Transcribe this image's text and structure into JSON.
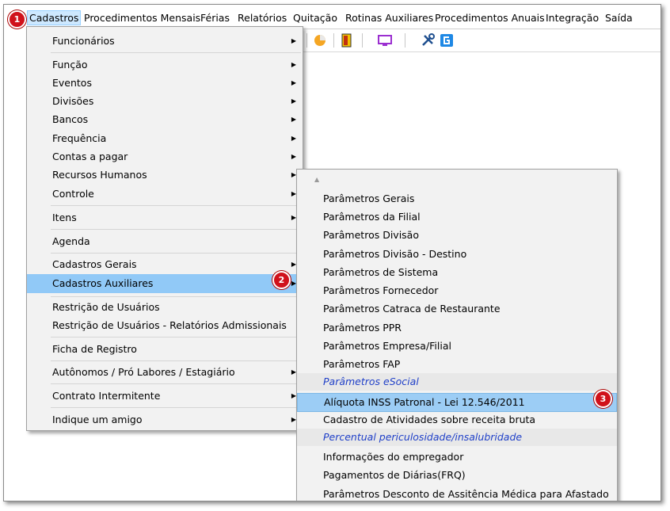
{
  "menubar": {
    "items": [
      "Cadastros",
      "Procedimentos Mensais",
      "Férias",
      "Relatórios",
      "Quitação",
      "Rotinas Auxiliares",
      "Procedimentos Anuais",
      "Integração",
      "Saída"
    ]
  },
  "toolbar": {
    "icons": [
      "pie-chart-icon",
      "exit-door-icon",
      "monitor-icon",
      "tools-icon",
      "app-settings-icon"
    ]
  },
  "callouts": [
    "1",
    "2",
    "3"
  ],
  "cadastros_menu": {
    "items": [
      {
        "label": "Funcionários",
        "submenu": true
      },
      {
        "label": "Função",
        "submenu": true
      },
      {
        "label": "Eventos",
        "submenu": true
      },
      {
        "label": "Divisões",
        "submenu": true
      },
      {
        "label": "Bancos",
        "submenu": true
      },
      {
        "label": "Frequência",
        "submenu": true
      },
      {
        "label": "Contas a pagar",
        "submenu": true
      },
      {
        "label": "Recursos Humanos",
        "submenu": true
      },
      {
        "label": "Controle",
        "submenu": true
      },
      {
        "label": "Itens",
        "submenu": true
      },
      {
        "label": "Agenda",
        "submenu": false
      },
      {
        "label": "Cadastros Gerais",
        "submenu": true
      },
      {
        "label": "Cadastros Auxiliares",
        "submenu": true,
        "highlighted": true
      },
      {
        "label": "Restrição de Usuários",
        "submenu": false
      },
      {
        "label": "Restrição de Usuários - Relatórios Admissionais",
        "submenu": false
      },
      {
        "label": "Ficha de Registro",
        "submenu": false
      },
      {
        "label": "Autônomos / Pró Labores / Estagiário",
        "submenu": true
      },
      {
        "label": "Contrato Intermitente",
        "submenu": true
      },
      {
        "label": "Indique um amigo",
        "submenu": true
      }
    ]
  },
  "auxiliares_menu": {
    "items": [
      {
        "label": "Parâmetros Gerais"
      },
      {
        "label": "Parâmetros da Filial"
      },
      {
        "label": "Parâmetros Divisão"
      },
      {
        "label": "Parâmetros Divisão - Destino"
      },
      {
        "label": "Parâmetros de Sistema"
      },
      {
        "label": "Parâmetros Fornecedor"
      },
      {
        "label": "Parâmetros Catraca de Restaurante"
      },
      {
        "label": "Parâmetros PPR"
      },
      {
        "label": "Parâmetros Empresa/Filial"
      },
      {
        "label": "Parâmetros FAP"
      },
      {
        "label": "Parâmetros eSocial",
        "group": true
      },
      {
        "label": "Alíquota INSS Patronal - Lei 12.546/2011",
        "highlighted": true
      },
      {
        "label": "Cadastro de Atividades sobre receita bruta"
      },
      {
        "label": "Percentual periculosidade/insalubridade",
        "group": true
      },
      {
        "label": "Informações do empregador"
      },
      {
        "label": "Pagamentos de Diárias(FRQ)"
      },
      {
        "label": "Parâmetros Desconto de Assitência Médica para Afastado"
      }
    ]
  },
  "colors": {
    "highlight": "#91c9f7",
    "group_text": "#2040c8",
    "badge": "#d0111b"
  }
}
